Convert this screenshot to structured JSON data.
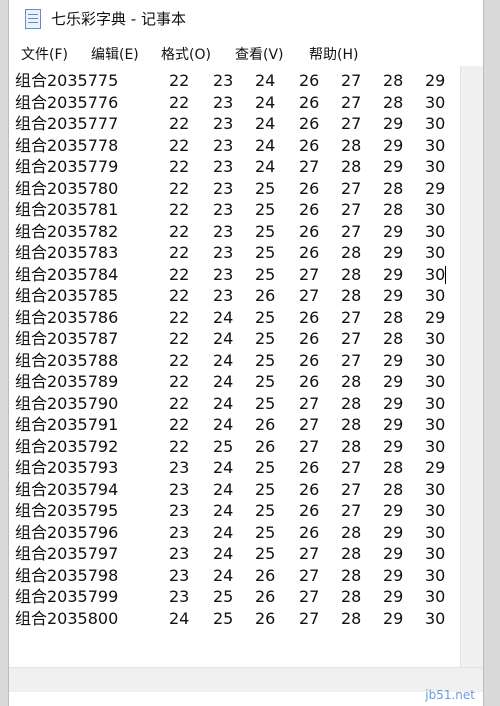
{
  "window": {
    "title": "七乐彩字典 - 记事本",
    "icon": "notepad-icon"
  },
  "menu": [
    {
      "label": "文件(F)"
    },
    {
      "label": "编辑(E)"
    },
    {
      "label": "格式(O)"
    },
    {
      "label": "查看(V)"
    },
    {
      "label": "帮助(H)"
    }
  ],
  "rows": [
    {
      "combo": "组合2035775",
      "numbers": [
        "22",
        "23",
        "24",
        "26",
        "27",
        "28",
        "29"
      ]
    },
    {
      "combo": "组合2035776",
      "numbers": [
        "22",
        "23",
        "24",
        "26",
        "27",
        "28",
        "30"
      ]
    },
    {
      "combo": "组合2035777",
      "numbers": [
        "22",
        "23",
        "24",
        "26",
        "27",
        "29",
        "30"
      ]
    },
    {
      "combo": "组合2035778",
      "numbers": [
        "22",
        "23",
        "24",
        "26",
        "28",
        "29",
        "30"
      ]
    },
    {
      "combo": "组合2035779",
      "numbers": [
        "22",
        "23",
        "24",
        "27",
        "28",
        "29",
        "30"
      ]
    },
    {
      "combo": "组合2035780",
      "numbers": [
        "22",
        "23",
        "25",
        "26",
        "27",
        "28",
        "29"
      ]
    },
    {
      "combo": "组合2035781",
      "numbers": [
        "22",
        "23",
        "25",
        "26",
        "27",
        "28",
        "30"
      ]
    },
    {
      "combo": "组合2035782",
      "numbers": [
        "22",
        "23",
        "25",
        "26",
        "27",
        "29",
        "30"
      ]
    },
    {
      "combo": "组合2035783",
      "numbers": [
        "22",
        "23",
        "25",
        "26",
        "28",
        "29",
        "30"
      ]
    },
    {
      "combo": "组合2035784",
      "numbers": [
        "22",
        "23",
        "25",
        "27",
        "28",
        "29",
        "30"
      ]
    },
    {
      "combo": "组合2035785",
      "numbers": [
        "22",
        "23",
        "26",
        "27",
        "28",
        "29",
        "30"
      ]
    },
    {
      "combo": "组合2035786",
      "numbers": [
        "22",
        "24",
        "25",
        "26",
        "27",
        "28",
        "29"
      ]
    },
    {
      "combo": "组合2035787",
      "numbers": [
        "22",
        "24",
        "25",
        "26",
        "27",
        "28",
        "30"
      ]
    },
    {
      "combo": "组合2035788",
      "numbers": [
        "22",
        "24",
        "25",
        "26",
        "27",
        "29",
        "30"
      ]
    },
    {
      "combo": "组合2035789",
      "numbers": [
        "22",
        "24",
        "25",
        "26",
        "28",
        "29",
        "30"
      ]
    },
    {
      "combo": "组合2035790",
      "numbers": [
        "22",
        "24",
        "25",
        "27",
        "28",
        "29",
        "30"
      ]
    },
    {
      "combo": "组合2035791",
      "numbers": [
        "22",
        "24",
        "26",
        "27",
        "28",
        "29",
        "30"
      ]
    },
    {
      "combo": "组合2035792",
      "numbers": [
        "22",
        "25",
        "26",
        "27",
        "28",
        "29",
        "30"
      ]
    },
    {
      "combo": "组合2035793",
      "numbers": [
        "23",
        "24",
        "25",
        "26",
        "27",
        "28",
        "29"
      ]
    },
    {
      "combo": "组合2035794",
      "numbers": [
        "23",
        "24",
        "25",
        "26",
        "27",
        "28",
        "30"
      ]
    },
    {
      "combo": "组合2035795",
      "numbers": [
        "23",
        "24",
        "25",
        "26",
        "27",
        "29",
        "30"
      ]
    },
    {
      "combo": "组合2035796",
      "numbers": [
        "23",
        "24",
        "25",
        "26",
        "28",
        "29",
        "30"
      ]
    },
    {
      "combo": "组合2035797",
      "numbers": [
        "23",
        "24",
        "25",
        "27",
        "28",
        "29",
        "30"
      ]
    },
    {
      "combo": "组合2035798",
      "numbers": [
        "23",
        "24",
        "26",
        "27",
        "28",
        "29",
        "30"
      ]
    },
    {
      "combo": "组合2035799",
      "numbers": [
        "23",
        "25",
        "26",
        "27",
        "28",
        "29",
        "30"
      ]
    },
    {
      "combo": "组合2035800",
      "numbers": [
        "24",
        "25",
        "26",
        "27",
        "28",
        "29",
        "30"
      ]
    }
  ],
  "caret_row_index": 9,
  "watermark": "jb51.net"
}
